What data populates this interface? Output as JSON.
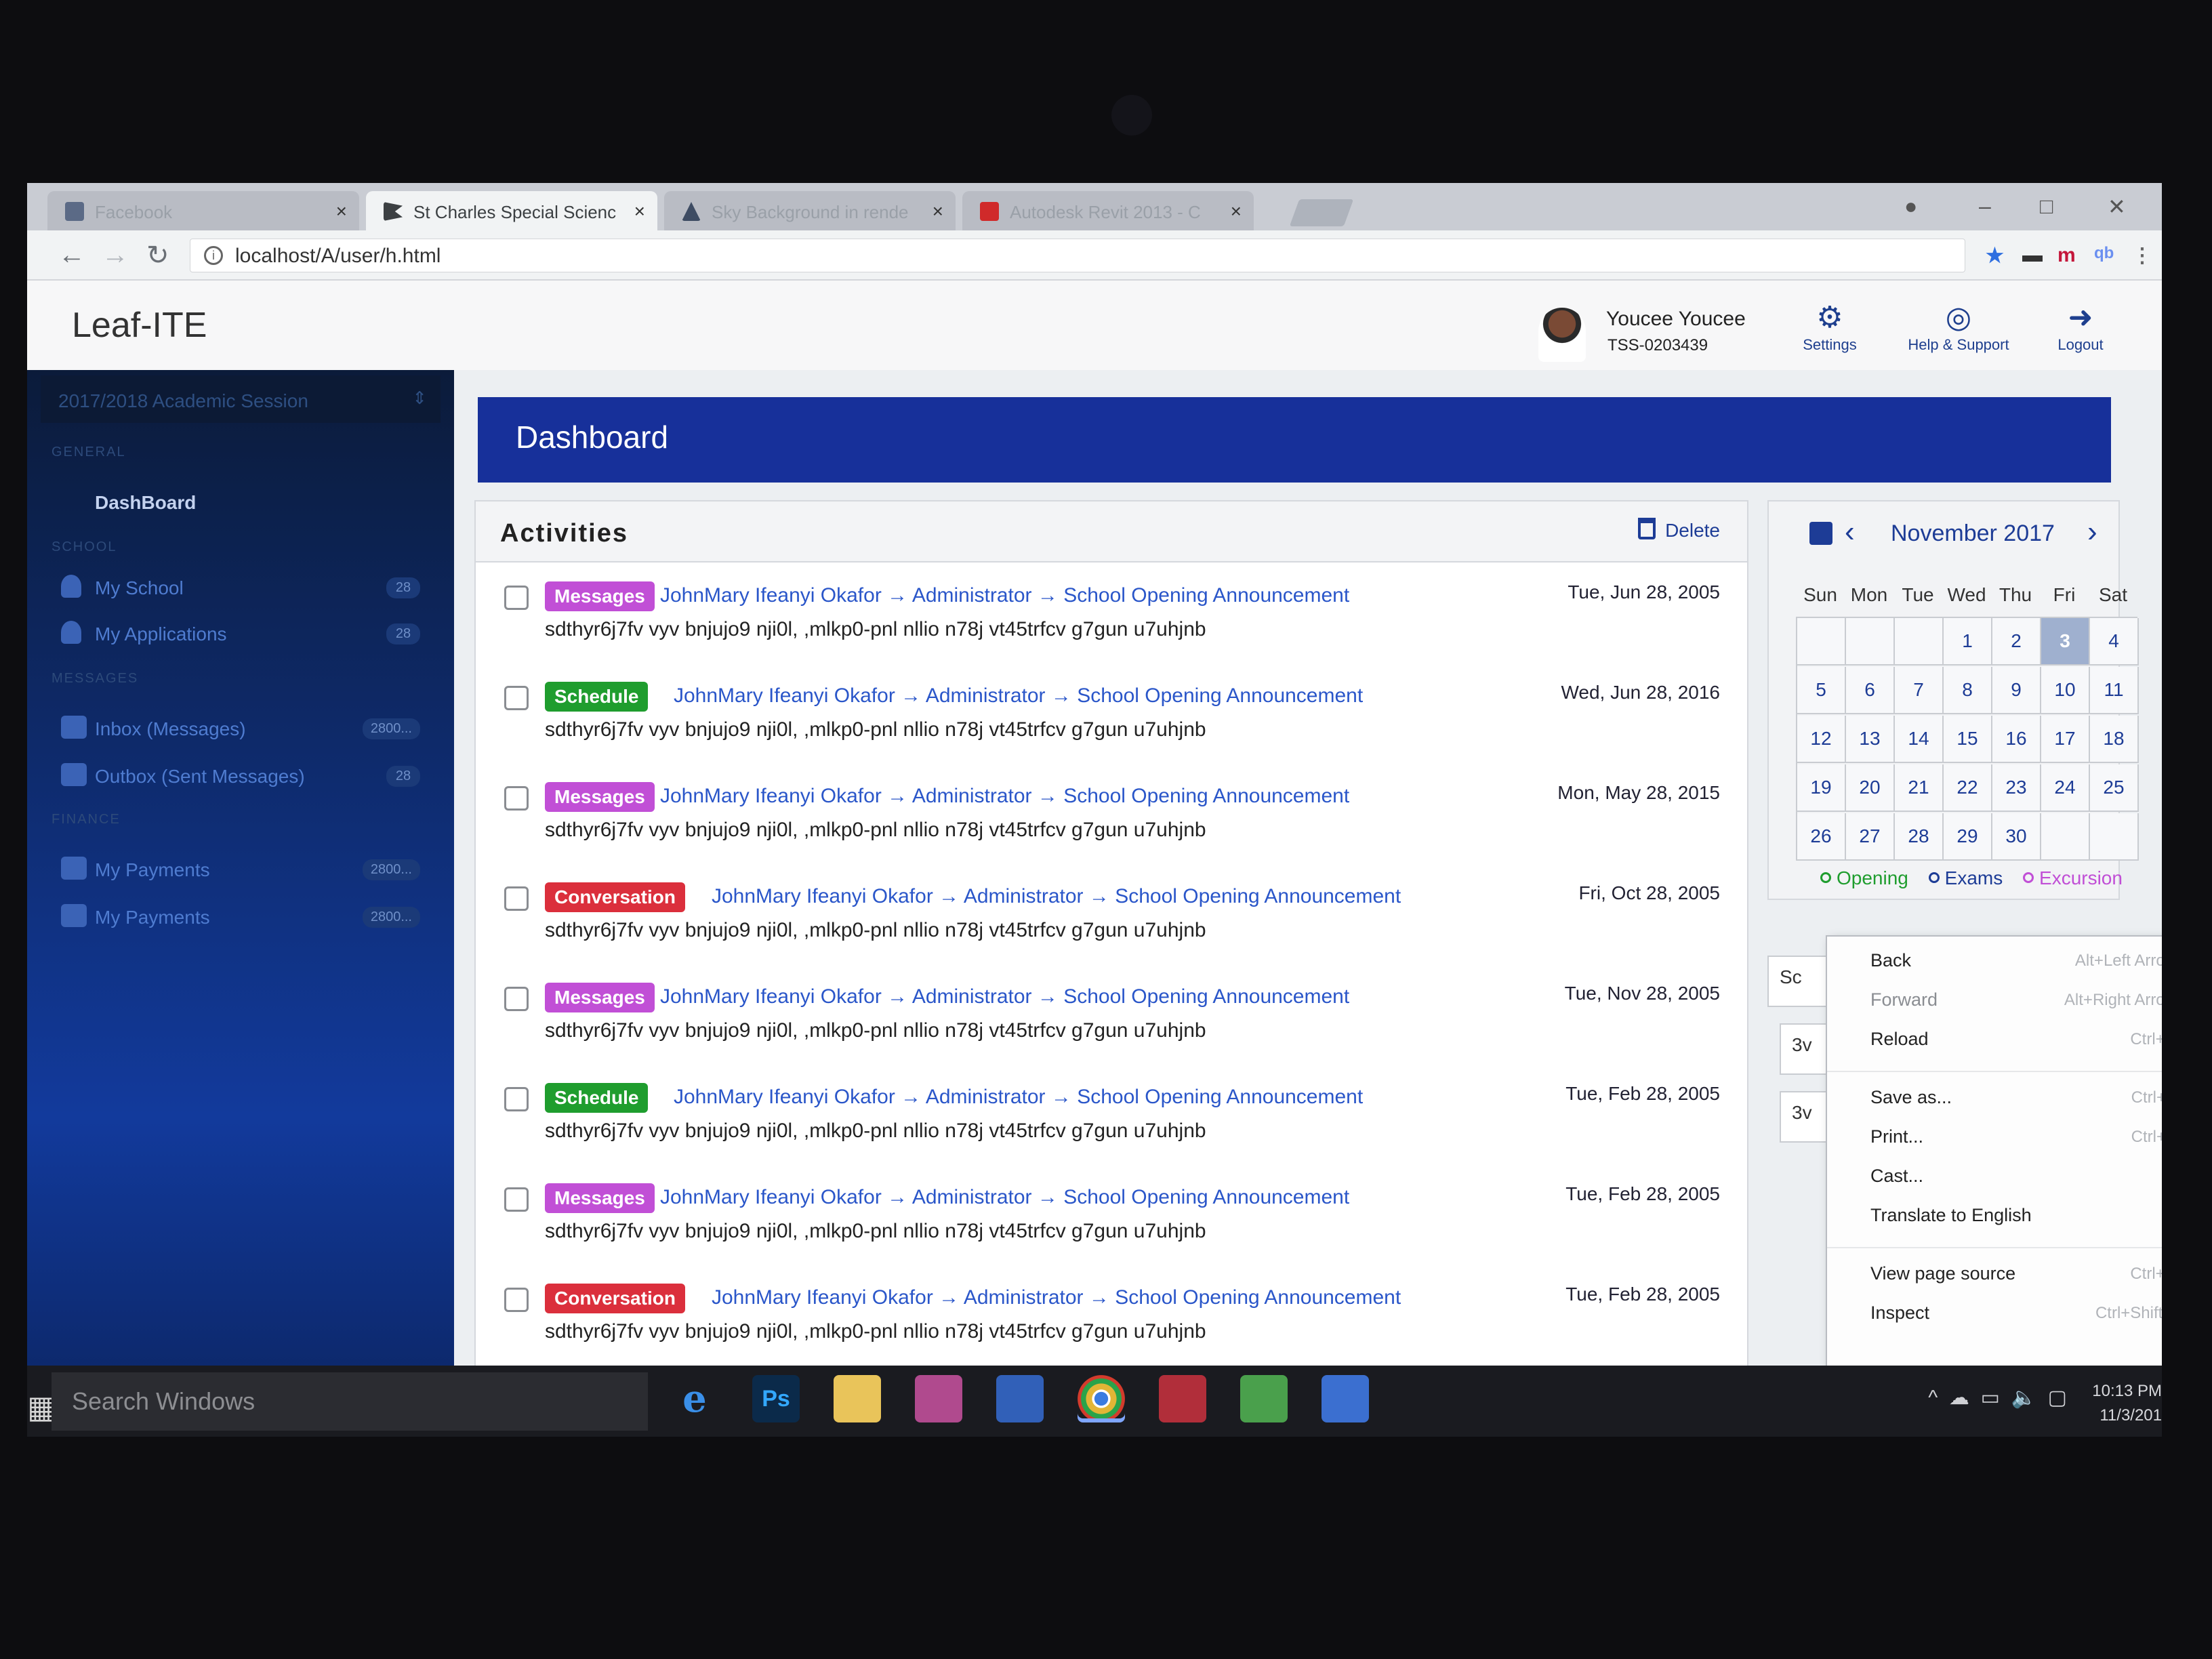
{
  "browser": {
    "tabs": [
      {
        "label": "Facebook",
        "icon": "facebook-icon"
      },
      {
        "label": "St Charles Special Scienc",
        "icon": "flag-icon"
      },
      {
        "label": "Sky Background in rende",
        "icon": "autodesk-icon"
      },
      {
        "label": "Autodesk Revit 2013 - C",
        "icon": "youtube-icon"
      }
    ],
    "url": "localhost/A/user/h.html",
    "extensions": [
      "m",
      "qb"
    ]
  },
  "app": {
    "logo": "Leaf-ITE",
    "user_name": "Youcee Youcee",
    "user_id": "TSS-0203439",
    "header_buttons": [
      {
        "label": "Settings",
        "icon": "gears-icon"
      },
      {
        "label": "Help & Support",
        "icon": "lifebuoy-icon"
      },
      {
        "label": "Logout",
        "icon": "logout-icon"
      }
    ]
  },
  "sidebar": {
    "session": "2017/2018 Academic Session",
    "sections": {
      "general": "GENERAL",
      "school": "SCHOOL",
      "messages": "MESSAGES",
      "finance": "FINANCE"
    },
    "dashboard": "DashBoard",
    "items": [
      {
        "label": "My School",
        "count": "28",
        "icon": "user-icon"
      },
      {
        "label": "My Applications",
        "count": "28",
        "icon": "user-icon"
      },
      {
        "label": "Inbox (Messages)",
        "count": "2800...",
        "icon": "inbox-icon"
      },
      {
        "label": "Outbox (Sent Messages)",
        "count": "28",
        "icon": "envelope-icon"
      },
      {
        "label": "My Payments",
        "count": "2800...",
        "icon": "money-icon"
      },
      {
        "label": "My Payments",
        "count": "2800...",
        "icon": "money-icon"
      }
    ]
  },
  "main": {
    "page_title": "Dashboard",
    "activities_title": "Activities",
    "delete_label": "Delete",
    "activities": [
      {
        "type": "Messages",
        "title": "JohnMary Ifeanyi Okafor → Administrator → School Opening Announcement",
        "body": "sdthyr6j7fv vyv bnjujo9 nji0l, ,mlkp0-pnl nllio n78j vt45trfcv g7gun u7uhjnb",
        "date": "Tue, Jun 28, 2005"
      },
      {
        "type": "Schedule",
        "title": "JohnMary Ifeanyi Okafor → Administrator → School Opening Announcement",
        "body": "sdthyr6j7fv vyv bnjujo9 nji0l, ,mlkp0-pnl nllio n78j vt45trfcv g7gun u7uhjnb",
        "date": "Wed, Jun 28, 2016"
      },
      {
        "type": "Messages",
        "title": "JohnMary Ifeanyi Okafor → Administrator → School Opening Announcement",
        "body": "sdthyr6j7fv vyv bnjujo9 nji0l, ,mlkp0-pnl nllio n78j vt45trfcv g7gun u7uhjnb",
        "date": "Mon, May 28, 2015"
      },
      {
        "type": "Conversation",
        "title": "JohnMary Ifeanyi Okafor → Administrator → School Opening Announcement",
        "body": "sdthyr6j7fv vyv bnjujo9 nji0l, ,mlkp0-pnl nllio n78j vt45trfcv g7gun u7uhjnb",
        "date": "Fri, Oct 28, 2005"
      },
      {
        "type": "Messages",
        "title": "JohnMary Ifeanyi Okafor → Administrator → School Opening Announcement",
        "body": "sdthyr6j7fv vyv bnjujo9 nji0l, ,mlkp0-pnl nllio n78j vt45trfcv g7gun u7uhjnb",
        "date": "Tue, Nov 28, 2005"
      },
      {
        "type": "Schedule",
        "title": "JohnMary Ifeanyi Okafor → Administrator → School Opening Announcement",
        "body": "sdthyr6j7fv vyv bnjujo9 nji0l, ,mlkp0-pnl nllio n78j vt45trfcv g7gun u7uhjnb",
        "date": "Tue, Feb 28, 2005"
      },
      {
        "type": "Messages",
        "title": "JohnMary Ifeanyi Okafor → Administrator → School Opening Announcement",
        "body": "sdthyr6j7fv vyv bnjujo9 nji0l, ,mlkp0-pnl nllio n78j vt45trfcv g7gun u7uhjnb",
        "date": "Tue, Feb 28, 2005"
      },
      {
        "type": "Conversation",
        "title": "JohnMary Ifeanyi Okafor → Administrator → School Opening Announcement",
        "body": "sdthyr6j7fv vyv bnjujo9 nji0l, ,mlkp0-pnl nllio n78j vt45trfcv g7gun u7uhjnb",
        "date": "Tue, Feb 28, 2005"
      }
    ]
  },
  "calendar": {
    "month": "November 2017",
    "weekdays": [
      "Sun",
      "Mon",
      "Tue",
      "Wed",
      "Thu",
      "Fri",
      "Sat"
    ],
    "days": [
      "",
      "",
      "",
      "1",
      "2",
      "3",
      "4",
      "5",
      "6",
      "7",
      "8",
      "9",
      "10",
      "11",
      "12",
      "13",
      "14",
      "15",
      "16",
      "17",
      "18",
      "19",
      "20",
      "21",
      "22",
      "23",
      "24",
      "25",
      "26",
      "27",
      "28",
      "29",
      "30",
      "",
      ""
    ],
    "today": "3",
    "legend": [
      {
        "label": "Opening",
        "color": "#1f9d2e"
      },
      {
        "label": "Exams",
        "color": "#1d3c96"
      },
      {
        "label": "Excursion",
        "color": "#c14fd6"
      }
    ],
    "stubs": [
      "Sc",
      "3v",
      "3v"
    ]
  },
  "context_menu": {
    "items": [
      {
        "label": "Back",
        "shortcut": "Alt+Left Arrow"
      },
      {
        "label": "Forward",
        "shortcut": "Alt+Right Arrow"
      },
      {
        "label": "Reload",
        "shortcut": "Ctrl+R"
      },
      {
        "label": "Save as...",
        "shortcut": "Ctrl+S"
      },
      {
        "label": "Print...",
        "shortcut": "Ctrl+P"
      },
      {
        "label": "Cast...",
        "shortcut": ""
      },
      {
        "label": "Translate to English",
        "shortcut": ""
      },
      {
        "label": "View page source",
        "shortcut": "Ctrl+U"
      },
      {
        "label": "Inspect",
        "shortcut": "Ctrl+Shift+I"
      }
    ]
  },
  "taskbar": {
    "search_placeholder": "Search Windows",
    "apps": [
      "e",
      "Ps"
    ],
    "clock_time": "10:13 PM",
    "clock_date": "11/3/201"
  },
  "colors": {
    "brand_blue": "#17309a",
    "link_blue": "#2a56c9",
    "messages": "#c14fd6",
    "schedule": "#1f9d2e",
    "conversation": "#db2f3c"
  }
}
